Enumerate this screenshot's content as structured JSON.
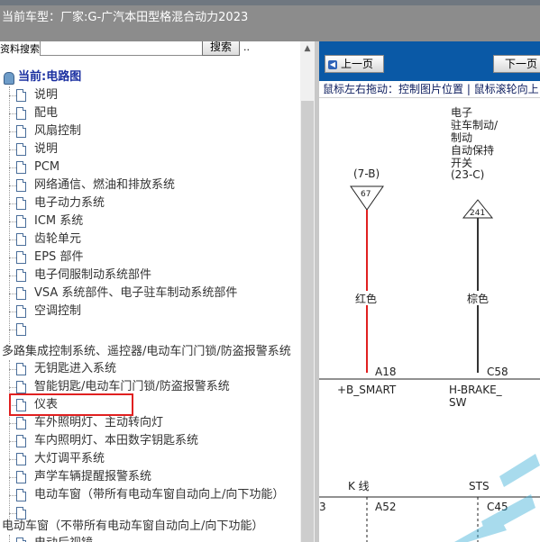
{
  "header": {
    "model_label": "当前车型：",
    "model_value": "厂家:G-广汽本田型格混合动力2023"
  },
  "search": {
    "label": "资料搜索",
    "button": "搜索",
    "extra": ".."
  },
  "tree": {
    "root": "当前:电路图",
    "items_a": [
      "说明",
      "配电",
      "风扇控制",
      "说明",
      "PCM",
      "网络通信、燃油和排放系统",
      "电子动力系统",
      "ICM 系统",
      "齿轮单元",
      "EPS 部件",
      "电子伺服制动系统部件",
      "VSA 系统部件、电子驻车制动系统部件",
      "空调控制",
      ""
    ],
    "group_1": "多路集成控制系统、遥控器/电动车门门锁/防盗报警系统",
    "items_b": [
      "无钥匙进入系统",
      "智能钥匙/电动车门门锁/防盗报警系统",
      "仪表",
      "车外照明灯、主动转向灯",
      "车内照明灯、本田数字钥匙系统",
      "大灯调平系统",
      "声学车辆提醒报警系统",
      "电动车窗（带所有电动车窗自动向上/向下功能）",
      ""
    ],
    "group_2": "电动车窗（不带所有电动车窗自动向上/向下功能）",
    "items_c": [
      "电动后视镜"
    ],
    "selected": "无钥匙进入系统"
  },
  "viewer": {
    "prev_label": "上一页",
    "next_label": "下一页",
    "hint": "鼠标左右拖动：控制图片位置 | 鼠标滚轮向上："
  },
  "diagram": {
    "component_lines": [
      "电子",
      "驻车制动/",
      "制动",
      "自动保持",
      "开关",
      "(23-C)"
    ],
    "left_conn": "(7-B)",
    "left_pin": "67",
    "right_pin": "241",
    "left_color": "红色",
    "right_color": "棕色",
    "left_term": "A18",
    "right_term": "C58",
    "left_signal": "+B_SMART",
    "right_signal_1": "H-BRAKE_",
    "right_signal_2": "SW",
    "bus_label": "K 线",
    "sts_label": "STS",
    "edge_num": "3",
    "bottom_term_1": "A52",
    "bottom_term_2": "C45"
  },
  "colors": {
    "banner": "#8c8c8c",
    "nav_bar": "#0a59a6",
    "highlight_border": "#e02020",
    "red_wire": "#e02020",
    "tree_root": "#1a2fa0"
  },
  "icons": [
    "page-icon",
    "shield-icon",
    "arrow-left-icon"
  ]
}
